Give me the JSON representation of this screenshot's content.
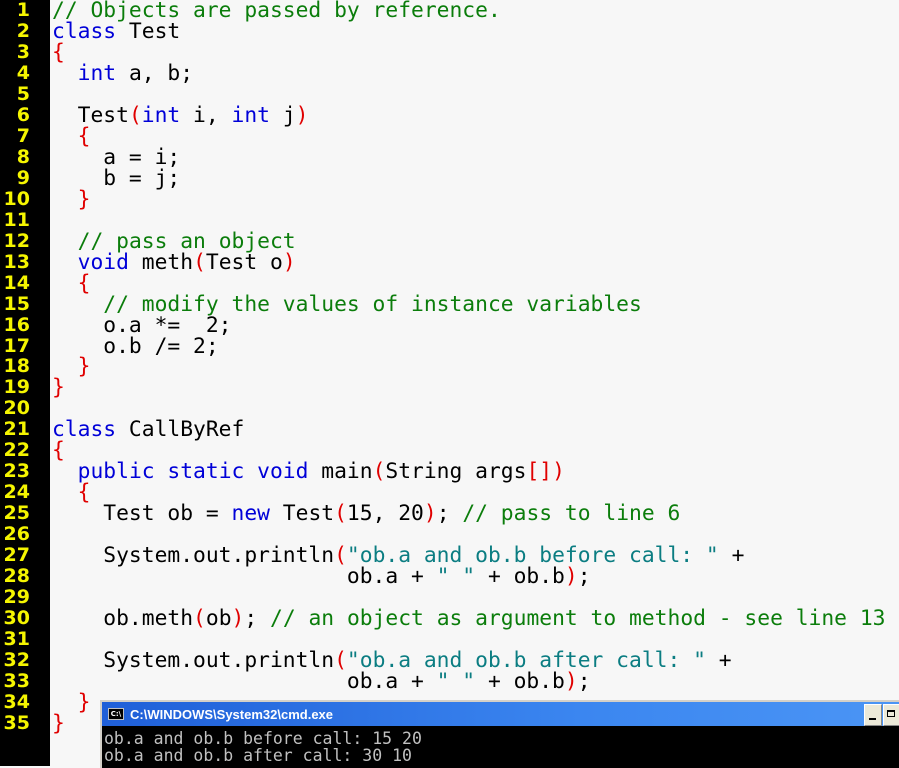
{
  "editor": {
    "line_numbers": [
      "1",
      "2",
      "3",
      "4",
      "5",
      "6",
      "7",
      "8",
      "9",
      "10",
      "11",
      "12",
      "13",
      "14",
      "15",
      "16",
      "17",
      "18",
      "19",
      "20",
      "21",
      "22",
      "23",
      "24",
      "25",
      "26",
      "27",
      "28",
      "29",
      "30",
      "31",
      "32",
      "33",
      "34",
      "35"
    ],
    "lines": [
      [
        {
          "t": "cm",
          "v": "// Objects are passed by reference."
        }
      ],
      [
        {
          "t": "kw",
          "v": "class"
        },
        {
          "t": "tx",
          "v": " Test"
        }
      ],
      [
        {
          "t": "br",
          "v": "{"
        }
      ],
      [
        {
          "t": "tx",
          "v": "  "
        },
        {
          "t": "kw",
          "v": "int"
        },
        {
          "t": "tx",
          "v": " a, b;"
        }
      ],
      [],
      [
        {
          "t": "tx",
          "v": "  Test"
        },
        {
          "t": "br",
          "v": "("
        },
        {
          "t": "kw",
          "v": "int"
        },
        {
          "t": "tx",
          "v": " i, "
        },
        {
          "t": "kw",
          "v": "int"
        },
        {
          "t": "tx",
          "v": " j"
        },
        {
          "t": "br",
          "v": ")"
        }
      ],
      [
        {
          "t": "tx",
          "v": "  "
        },
        {
          "t": "br",
          "v": "{"
        }
      ],
      [
        {
          "t": "tx",
          "v": "    a = i;"
        }
      ],
      [
        {
          "t": "tx",
          "v": "    b = j;"
        }
      ],
      [
        {
          "t": "tx",
          "v": "  "
        },
        {
          "t": "br",
          "v": "}"
        }
      ],
      [],
      [
        {
          "t": "tx",
          "v": "  "
        },
        {
          "t": "cm",
          "v": "// pass an object"
        }
      ],
      [
        {
          "t": "tx",
          "v": "  "
        },
        {
          "t": "kw",
          "v": "void"
        },
        {
          "t": "tx",
          "v": " meth"
        },
        {
          "t": "br",
          "v": "("
        },
        {
          "t": "tx",
          "v": "Test o"
        },
        {
          "t": "br",
          "v": ")"
        }
      ],
      [
        {
          "t": "tx",
          "v": "  "
        },
        {
          "t": "br",
          "v": "{"
        }
      ],
      [
        {
          "t": "tx",
          "v": "    "
        },
        {
          "t": "cm",
          "v": "// modify the values of instance variables"
        }
      ],
      [
        {
          "t": "tx",
          "v": "    o.a *=  2;"
        }
      ],
      [
        {
          "t": "tx",
          "v": "    o.b /= 2;"
        }
      ],
      [
        {
          "t": "tx",
          "v": "  "
        },
        {
          "t": "br",
          "v": "}"
        }
      ],
      [
        {
          "t": "br",
          "v": "}"
        }
      ],
      [],
      [
        {
          "t": "kw",
          "v": "class"
        },
        {
          "t": "tx",
          "v": " CallByRef"
        }
      ],
      [
        {
          "t": "br",
          "v": "{"
        }
      ],
      [
        {
          "t": "tx",
          "v": "  "
        },
        {
          "t": "kw",
          "v": "public static void"
        },
        {
          "t": "tx",
          "v": " main"
        },
        {
          "t": "br",
          "v": "("
        },
        {
          "t": "tx",
          "v": "String args"
        },
        {
          "t": "br",
          "v": "[])"
        }
      ],
      [
        {
          "t": "tx",
          "v": "  "
        },
        {
          "t": "br",
          "v": "{"
        }
      ],
      [
        {
          "t": "tx",
          "v": "    Test ob = "
        },
        {
          "t": "kw",
          "v": "new"
        },
        {
          "t": "tx",
          "v": " Test"
        },
        {
          "t": "br",
          "v": "("
        },
        {
          "t": "tx",
          "v": "15, 20"
        },
        {
          "t": "br",
          "v": ")"
        },
        {
          "t": "tx",
          "v": "; "
        },
        {
          "t": "cm",
          "v": "// pass to line 6"
        }
      ],
      [],
      [
        {
          "t": "tx",
          "v": "    System.out.println"
        },
        {
          "t": "br",
          "v": "("
        },
        {
          "t": "st",
          "v": "\"ob.a and ob.b before call: \""
        },
        {
          "t": "tx",
          "v": " +"
        }
      ],
      [
        {
          "t": "tx",
          "v": "                       ob.a + "
        },
        {
          "t": "st",
          "v": "\" \""
        },
        {
          "t": "tx",
          "v": " + ob.b"
        },
        {
          "t": "br",
          "v": ")"
        },
        {
          "t": "tx",
          "v": ";"
        }
      ],
      [],
      [
        {
          "t": "tx",
          "v": "    ob.meth"
        },
        {
          "t": "br",
          "v": "("
        },
        {
          "t": "tx",
          "v": "ob"
        },
        {
          "t": "br",
          "v": ")"
        },
        {
          "t": "tx",
          "v": "; "
        },
        {
          "t": "cm",
          "v": "// an object as argument to method - see line 13"
        }
      ],
      [],
      [
        {
          "t": "tx",
          "v": "    System.out.println"
        },
        {
          "t": "br",
          "v": "("
        },
        {
          "t": "st",
          "v": "\"ob.a and ob.b after call: \""
        },
        {
          "t": "tx",
          "v": " +"
        }
      ],
      [
        {
          "t": "tx",
          "v": "                       ob.a + "
        },
        {
          "t": "st",
          "v": "\" \""
        },
        {
          "t": "tx",
          "v": " + ob.b"
        },
        {
          "t": "br",
          "v": ")"
        },
        {
          "t": "tx",
          "v": ";"
        }
      ],
      [
        {
          "t": "tx",
          "v": "  "
        },
        {
          "t": "br",
          "v": "}"
        }
      ],
      [
        {
          "t": "br",
          "v": "}"
        }
      ]
    ]
  },
  "console": {
    "icon": "cmd-window-icon",
    "icon_text": "C:\\",
    "title": "C:\\WINDOWS\\System32\\cmd.exe",
    "output": [
      "ob.a and ob.b before call: 15 20",
      "ob.a and ob.b after call: 30 10"
    ]
  },
  "colors": {
    "keyword": "#0000d8",
    "comment": "#0b7d0b",
    "string": "#0b7d82",
    "bracket": "#e00000",
    "line_number": "#f5f500",
    "titlebar": "#3b86f0"
  }
}
